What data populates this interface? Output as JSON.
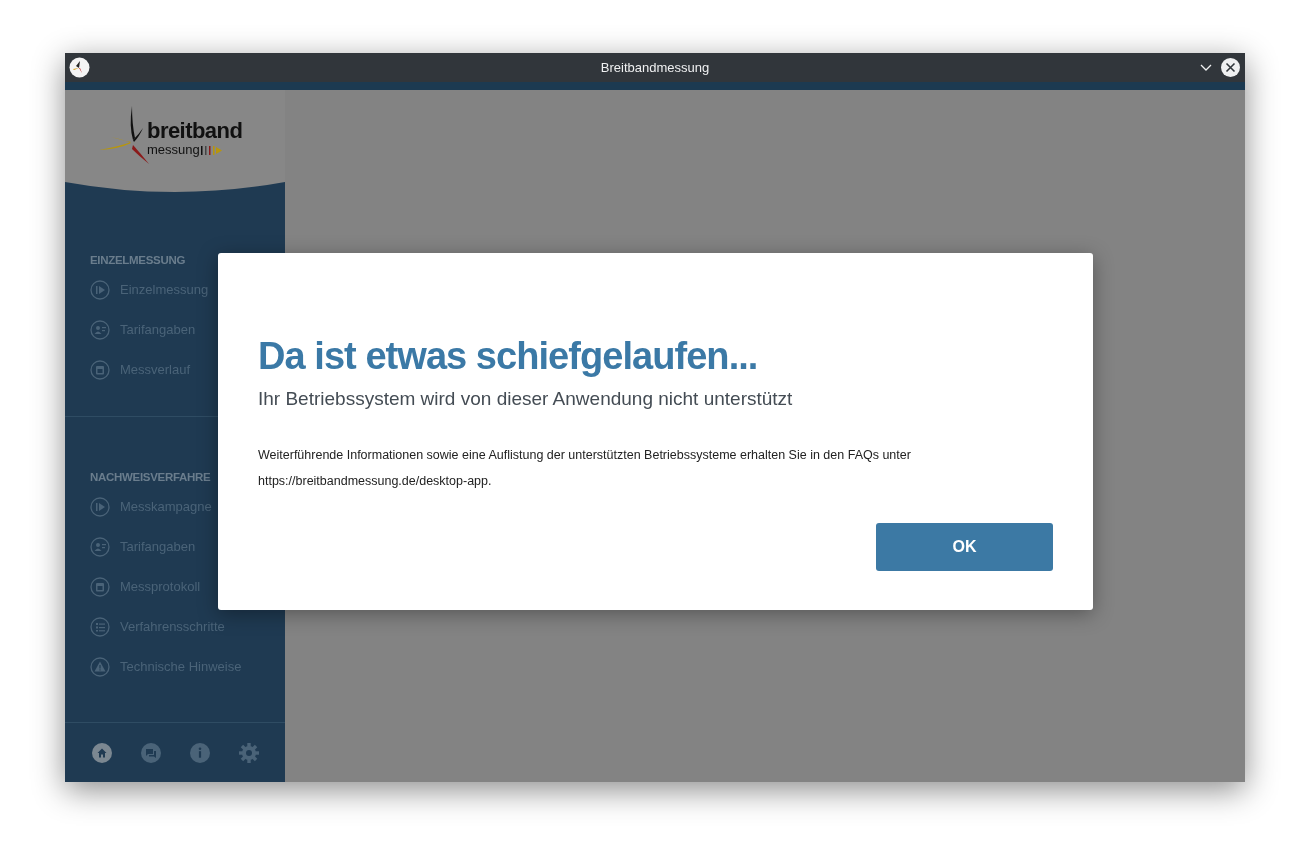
{
  "window": {
    "title": "Breitbandmessung"
  },
  "logo": {
    "word": "breitband",
    "subword": "messung"
  },
  "sidebar": {
    "sections": [
      {
        "heading": "EINZELMESSUNG",
        "items": [
          "Einzelmessung",
          "Tarifangaben",
          "Messverlauf"
        ]
      },
      {
        "heading": "NACHWEISVERFAHRE",
        "items": [
          "Messkampagne",
          "Tarifangaben",
          "Messprotokoll",
          "Verfahrensschritte",
          "Technische Hinweise"
        ]
      }
    ],
    "bottom_nav": [
      {
        "selected": true
      },
      {
        "selected": false
      },
      {
        "selected": false
      },
      {
        "selected": false
      }
    ]
  },
  "dialog": {
    "title": "Da ist etwas schiefgelaufen...",
    "subtitle": "Ihr Betriebssystem wird von dieser Anwendung nicht unterstützt",
    "body": [
      "Weiterführende Informationen sowie eine Auflistung der unterstützten Betriebssysteme erhalten Sie in den FAQs unter",
      "https://breitbandmessung.de/desktop-app."
    ],
    "button": "OK"
  }
}
